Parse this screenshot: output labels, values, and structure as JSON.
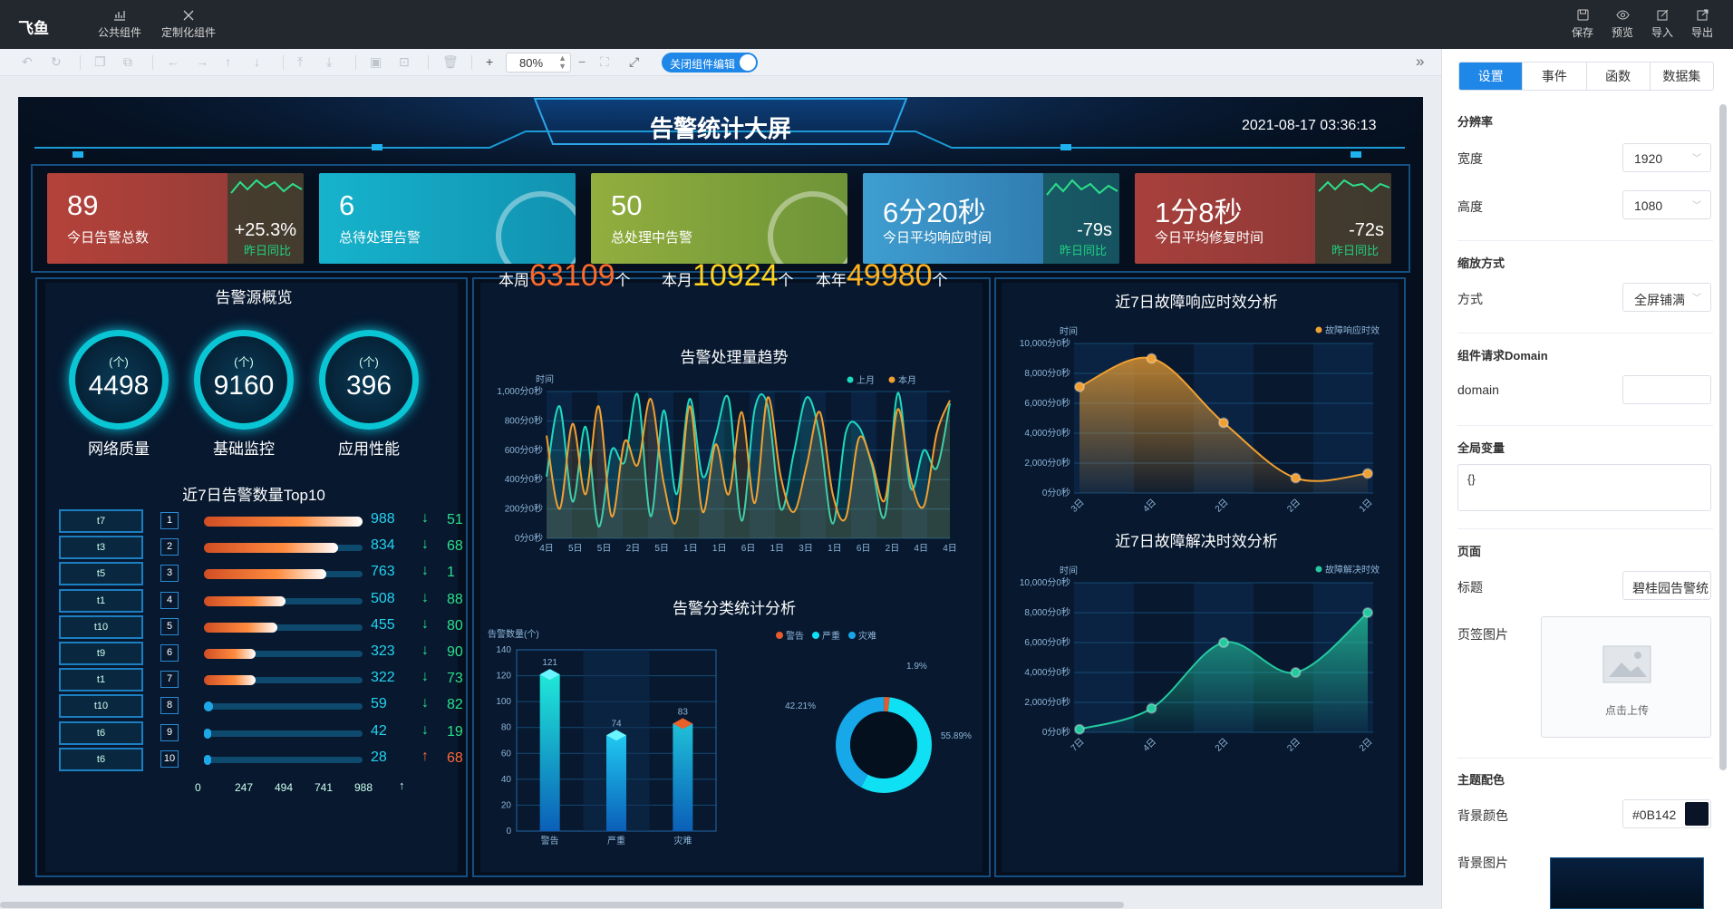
{
  "app": {
    "logo": "飞鱼"
  },
  "topbar": {
    "left": [
      {
        "icon": "chart-icon",
        "label": "公共组件"
      },
      {
        "icon": "custom-icon",
        "label": "定制化组件"
      }
    ],
    "right": [
      {
        "icon": "save-icon",
        "label": "保存"
      },
      {
        "icon": "preview-icon",
        "label": "预览"
      },
      {
        "icon": "import-icon",
        "label": "导入"
      },
      {
        "icon": "export-icon",
        "label": "导出"
      }
    ]
  },
  "toolbar": {
    "zoom": "80%",
    "toggle_label": "关闭组件编辑",
    "plus": "+",
    "minus": "−"
  },
  "right_panel": {
    "tabs": [
      "设置",
      "事件",
      "函数",
      "数据集"
    ],
    "resolution_title": "分辨率",
    "width_label": "宽度",
    "width_value": "1920",
    "height_label": "高度",
    "height_value": "1080",
    "scale_title": "缩放方式",
    "mode_label": "方式",
    "mode_value": "全屏铺满",
    "domain_title": "组件请求Domain",
    "domain_label": "domain",
    "domain_value": "",
    "global_title": "全局变量",
    "global_value": "{}",
    "page_title": "页面",
    "title_label": "标题",
    "title_value": "碧桂园告警统",
    "tab_image_label": "页签图片",
    "upload_label": "点击上传",
    "theme_title": "主题配色",
    "bg_color_label": "背景颜色",
    "bg_color_value": "#0B142",
    "bg_image_label": "背景图片",
    "colors": {
      "accent": "#1f87e8",
      "bg_swatch": "#0B1427"
    }
  },
  "screen": {
    "title": "告警统计大屏",
    "datetime": "2021-08-17 03:36:13",
    "kpis": [
      {
        "value": "89",
        "label": "今日告警总数",
        "change": "+25.3%",
        "sub": "昨日同比",
        "color": "#b4423a"
      },
      {
        "value": "6",
        "label": "总待处理告警",
        "color": "#19a9c4"
      },
      {
        "value": "50",
        "label": "总处理中告警",
        "color": "#8aa83c"
      },
      {
        "value": "6分20秒",
        "label": "今日平均响应时间",
        "change": "-79s",
        "sub": "昨日同比",
        "color": "#3f8fc0"
      },
      {
        "value": "1分8秒",
        "label": "今日平均修复时间",
        "change": "-72s",
        "sub": "昨日同比",
        "color": "#a53e3b"
      }
    ],
    "source_overview": {
      "title": "告警源概览",
      "gauges": [
        {
          "unit": "(个)",
          "value": "4498",
          "label": "网络质量"
        },
        {
          "unit": "(个)",
          "value": "9160",
          "label": "基础监控"
        },
        {
          "unit": "(个)",
          "value": "396",
          "label": "应用性能"
        }
      ]
    },
    "top10": {
      "title": "近7日告警数量Top10",
      "axis": [
        "0",
        "247",
        "494",
        "741",
        "988"
      ],
      "axis_arrow": "↑",
      "rows": [
        {
          "tag": "t7",
          "rank": "1",
          "value": 988,
          "trend": "down",
          "delta": "51"
        },
        {
          "tag": "t3",
          "rank": "2",
          "value": 834,
          "trend": "down",
          "delta": "68"
        },
        {
          "tag": "t5",
          "rank": "3",
          "value": 763,
          "trend": "down",
          "delta": "1"
        },
        {
          "tag": "t1",
          "rank": "4",
          "value": 508,
          "trend": "down",
          "delta": "88"
        },
        {
          "tag": "t10",
          "rank": "5",
          "value": 455,
          "trend": "down",
          "delta": "80"
        },
        {
          "tag": "t9",
          "rank": "6",
          "value": 323,
          "trend": "down",
          "delta": "90"
        },
        {
          "tag": "t1",
          "rank": "7",
          "value": 322,
          "trend": "down",
          "delta": "73"
        },
        {
          "tag": "t10",
          "rank": "8",
          "value": 59,
          "trend": "down",
          "delta": "82"
        },
        {
          "tag": "t6",
          "rank": "9",
          "value": 42,
          "trend": "down",
          "delta": "19"
        },
        {
          "tag": "t6",
          "rank": "10",
          "value": 28,
          "trend": "up",
          "delta": "68"
        }
      ]
    },
    "stats": [
      {
        "prefix": "本周",
        "value": "63109",
        "suffix": "个",
        "color": "#ff6a2a"
      },
      {
        "prefix": "本月",
        "value": "10924",
        "suffix": "个",
        "color": "#ffd21f"
      },
      {
        "prefix": "本年",
        "value": "49980",
        "suffix": "个",
        "color": "#ffb21f"
      }
    ],
    "trend_title": "告警处理量趋势",
    "category_title": "告警分类统计分析",
    "response_title": "近7日故障响应时效分析",
    "resolve_title": "近7日故障解决时效分析"
  },
  "chart_data": [
    {
      "type": "line",
      "title": "告警处理量趋势",
      "ylabel": "时间",
      "ylim": [
        0,
        1000
      ],
      "yticks": [
        "0分0秒",
        "200分0秒",
        "400分0秒",
        "600分0秒",
        "800分0秒",
        "1,000分0秒"
      ],
      "x": [
        "4日",
        "5日",
        "5日",
        "2日",
        "5日",
        "1日",
        "1日",
        "6日",
        "1日",
        "3日",
        "1日",
        "6日",
        "2日",
        "4日",
        "4日"
      ],
      "series": [
        {
          "name": "上月",
          "color": "#1fd8c0",
          "values": [
            420,
            900,
            250,
            760,
            80,
            600,
            520,
            980,
            150,
            870,
            300,
            950,
            420,
            700,
            950,
            120,
            880,
            900,
            200,
            580,
            960,
            700,
            100,
            720,
            760,
            500,
            150,
            990,
            340,
            600,
            480,
            920
          ]
        },
        {
          "name": "本月",
          "color": "#f0a030",
          "values": [
            700,
            200,
            780,
            300,
            900,
            150,
            660,
            500,
            950,
            380,
            120,
            900,
            180,
            640,
            300,
            860,
            240,
            960,
            420,
            180,
            500,
            860,
            300,
            140,
            680,
            520,
            260,
            880,
            400,
            220,
            720,
            940
          ]
        }
      ]
    },
    {
      "type": "bar",
      "ylabel": "告警数量(个)",
      "ylim": [
        0,
        140
      ],
      "yticks": [
        0,
        20,
        40,
        60,
        80,
        100,
        120,
        140
      ],
      "categories": [
        "警告",
        "严重",
        "灾难"
      ],
      "values": [
        121,
        74,
        83
      ]
    },
    {
      "type": "pie",
      "series": [
        {
          "name": "警告",
          "value": 1.9,
          "label": "1.9%",
          "color": "#e55b2b"
        },
        {
          "name": "严重",
          "value": 55.89,
          "label": "55.89%",
          "color": "#10e0f4"
        },
        {
          "name": "灾难",
          "value": 42.21,
          "label": "42.21%",
          "color": "#16a8e8"
        }
      ]
    },
    {
      "type": "area",
      "title": "近7日故障响应时效分析",
      "ylabel": "时间",
      "yticks": [
        "0分0秒",
        "2,000分0秒",
        "4,000分0秒",
        "6,000分0秒",
        "8,000分0秒",
        "10,000分0秒"
      ],
      "ylim": [
        0,
        10000
      ],
      "x": [
        "3日",
        "4日",
        "2日",
        "2日",
        "1日"
      ],
      "series": [
        {
          "name": "故障响应时效",
          "color": "#f0a030",
          "values": [
            7100,
            9000,
            4700,
            1000,
            1300
          ]
        }
      ]
    },
    {
      "type": "area",
      "title": "近7日故障解决时效分析",
      "ylabel": "时间",
      "yticks": [
        "0分0秒",
        "2,000分0秒",
        "4,000分0秒",
        "6,000分0秒",
        "8,000分0秒",
        "10,000分0秒"
      ],
      "ylim": [
        0,
        10000
      ],
      "x": [
        "7日",
        "4日",
        "2日",
        "2日",
        "2日"
      ],
      "series": [
        {
          "name": "故障解决时效",
          "color": "#24c9a0",
          "values": [
            200,
            1600,
            6000,
            4000,
            8000
          ]
        }
      ]
    }
  ]
}
